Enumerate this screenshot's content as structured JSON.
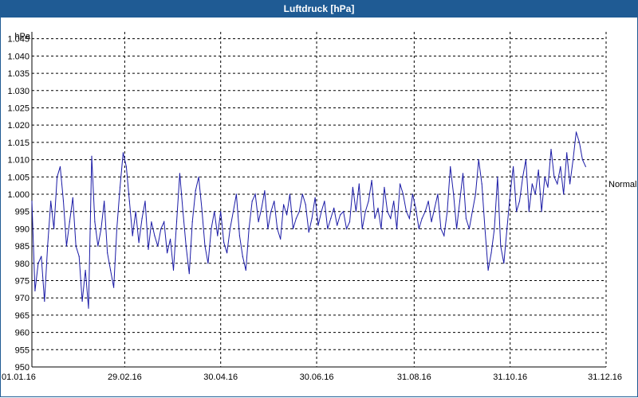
{
  "window": {
    "title": "Luftdruck [hPa]"
  },
  "chart_data": {
    "type": "line",
    "title": "Luftdruck [hPa]",
    "ylabel": "hPa",
    "ylim": [
      950,
      1047
    ],
    "y_ticks": [
      {
        "value": 1045,
        "label": "1.045"
      },
      {
        "value": 1040,
        "label": "1.040"
      },
      {
        "value": 1035,
        "label": "1.035"
      },
      {
        "value": 1030,
        "label": "1.030"
      },
      {
        "value": 1025,
        "label": "1.025"
      },
      {
        "value": 1020,
        "label": "1.020"
      },
      {
        "value": 1015,
        "label": "1.015"
      },
      {
        "value": 1010,
        "label": "1.010"
      },
      {
        "value": 1005,
        "label": "1.005"
      },
      {
        "value": 1000,
        "label": "1.000"
      },
      {
        "value": 995,
        "label": "995"
      },
      {
        "value": 990,
        "label": "990"
      },
      {
        "value": 985,
        "label": "985"
      },
      {
        "value": 980,
        "label": "980"
      },
      {
        "value": 975,
        "label": "975"
      },
      {
        "value": 970,
        "label": "970"
      },
      {
        "value": 965,
        "label": "965"
      },
      {
        "value": 960,
        "label": "960"
      },
      {
        "value": 955,
        "label": "955"
      },
      {
        "value": 950,
        "label": "950"
      }
    ],
    "x_ticks": [
      "01.01.16",
      "29.02.16",
      "30.04.16",
      "30.06.16",
      "31.08.16",
      "31.10.16",
      "31.12.16"
    ],
    "grid": true,
    "reference_line": {
      "label": "Normal",
      "value": 1003
    },
    "series": [
      {
        "color": "#1a1aa6",
        "points": [
          [
            "01.01.16",
            998
          ],
          [
            "03.01.16",
            972
          ],
          [
            "05.01.16",
            980
          ],
          [
            "07.01.16",
            982
          ],
          [
            "09.01.16",
            969
          ],
          [
            "11.01.16",
            985
          ],
          [
            "13.01.16",
            998
          ],
          [
            "15.01.16",
            990
          ],
          [
            "17.01.16",
            1005
          ],
          [
            "19.01.16",
            1008
          ],
          [
            "21.01.16",
            998
          ],
          [
            "23.01.16",
            985
          ],
          [
            "25.01.16",
            992
          ],
          [
            "27.01.16",
            999
          ],
          [
            "29.01.16",
            985
          ],
          [
            "31.01.16",
            982
          ],
          [
            "02.02.16",
            969
          ],
          [
            "04.02.16",
            978
          ],
          [
            "06.02.16",
            967
          ],
          [
            "08.02.16",
            1011
          ],
          [
            "10.02.16",
            992
          ],
          [
            "12.02.16",
            985
          ],
          [
            "14.02.16",
            990
          ],
          [
            "16.02.16",
            998
          ],
          [
            "18.02.16",
            983
          ],
          [
            "20.02.16",
            978
          ],
          [
            "22.02.16",
            973
          ],
          [
            "24.02.16",
            990
          ],
          [
            "26.02.16",
            1002
          ],
          [
            "28.02.16",
            1012
          ],
          [
            "01.03.16",
            1008
          ],
          [
            "03.03.16",
            998
          ],
          [
            "05.03.16",
            988
          ],
          [
            "07.03.16",
            995
          ],
          [
            "09.03.16",
            986
          ],
          [
            "11.03.16",
            993
          ],
          [
            "13.03.16",
            998
          ],
          [
            "15.03.16",
            984
          ],
          [
            "17.03.16",
            992
          ],
          [
            "19.03.16",
            988
          ],
          [
            "21.03.16",
            985
          ],
          [
            "23.03.16",
            990
          ],
          [
            "25.03.16",
            992
          ],
          [
            "27.03.16",
            983
          ],
          [
            "29.03.16",
            987
          ],
          [
            "31.03.16",
            978
          ],
          [
            "02.04.16",
            992
          ],
          [
            "04.04.16",
            1006
          ],
          [
            "06.04.16",
            995
          ],
          [
            "08.04.16",
            985
          ],
          [
            "10.04.16",
            977
          ],
          [
            "12.04.16",
            992
          ],
          [
            "14.04.16",
            1001
          ],
          [
            "16.04.16",
            1005
          ],
          [
            "18.04.16",
            996
          ],
          [
            "20.04.16",
            985
          ],
          [
            "22.04.16",
            980
          ],
          [
            "24.04.16",
            990
          ],
          [
            "26.04.16",
            995
          ],
          [
            "28.04.16",
            988
          ],
          [
            "30.04.16",
            995
          ],
          [
            "02.05.16",
            986
          ],
          [
            "04.05.16",
            983
          ],
          [
            "06.05.16",
            990
          ],
          [
            "08.05.16",
            995
          ],
          [
            "10.05.16",
            1000
          ],
          [
            "12.05.16",
            988
          ],
          [
            "14.05.16",
            982
          ],
          [
            "16.05.16",
            978
          ],
          [
            "18.05.16",
            990
          ],
          [
            "20.05.16",
            998
          ],
          [
            "22.05.16",
            1000
          ],
          [
            "24.05.16",
            992
          ],
          [
            "26.05.16",
            996
          ],
          [
            "28.05.16",
            1001
          ],
          [
            "30.05.16",
            990
          ],
          [
            "01.06.16",
            995
          ],
          [
            "03.06.16",
            998
          ],
          [
            "05.06.16",
            990
          ],
          [
            "07.06.16",
            987
          ],
          [
            "09.06.16",
            997
          ],
          [
            "11.06.16",
            994
          ],
          [
            "13.06.16",
            1000
          ],
          [
            "15.06.16",
            990
          ],
          [
            "17.06.16",
            993
          ],
          [
            "19.06.16",
            995
          ],
          [
            "21.06.16",
            1000
          ],
          [
            "23.06.16",
            997
          ],
          [
            "25.06.16",
            989
          ],
          [
            "27.06.16",
            993
          ],
          [
            "29.06.16",
            999
          ],
          [
            "01.07.16",
            991
          ],
          [
            "03.07.16",
            995
          ],
          [
            "05.07.16",
            998
          ],
          [
            "07.07.16",
            990
          ],
          [
            "09.07.16",
            993
          ],
          [
            "11.07.16",
            996
          ],
          [
            "13.07.16",
            991
          ],
          [
            "15.07.16",
            994
          ],
          [
            "17.07.16",
            995
          ],
          [
            "19.07.16",
            990
          ],
          [
            "21.07.16",
            992
          ],
          [
            "23.07.16",
            1002
          ],
          [
            "25.07.16",
            995
          ],
          [
            "27.07.16",
            1003
          ],
          [
            "29.07.16",
            990
          ],
          [
            "31.07.16",
            995
          ],
          [
            "02.08.16",
            998
          ],
          [
            "04.08.16",
            1004
          ],
          [
            "06.08.16",
            993
          ],
          [
            "08.08.16",
            996
          ],
          [
            "10.08.16",
            990
          ],
          [
            "12.08.16",
            1002
          ],
          [
            "14.08.16",
            995
          ],
          [
            "16.08.16",
            993
          ],
          [
            "18.08.16",
            998
          ],
          [
            "20.08.16",
            990
          ],
          [
            "22.08.16",
            1003
          ],
          [
            "24.08.16",
            1000
          ],
          [
            "26.08.16",
            995
          ],
          [
            "28.08.16",
            993
          ],
          [
            "30.08.16",
            1000
          ],
          [
            "01.09.16",
            996
          ],
          [
            "03.09.16",
            990
          ],
          [
            "05.09.16",
            993
          ],
          [
            "07.09.16",
            995
          ],
          [
            "09.09.16",
            998
          ],
          [
            "11.09.16",
            992
          ],
          [
            "13.09.16",
            996
          ],
          [
            "15.09.16",
            1000
          ],
          [
            "17.09.16",
            990
          ],
          [
            "19.09.16",
            988
          ],
          [
            "21.09.16",
            995
          ],
          [
            "23.09.16",
            1008
          ],
          [
            "25.09.16",
            1000
          ],
          [
            "27.09.16",
            990
          ],
          [
            "29.09.16",
            998
          ],
          [
            "01.10.16",
            1006
          ],
          [
            "03.10.16",
            993
          ],
          [
            "05.10.16",
            990
          ],
          [
            "07.10.16",
            995
          ],
          [
            "09.10.16",
            1000
          ],
          [
            "11.10.16",
            1010
          ],
          [
            "13.10.16",
            1003
          ],
          [
            "15.10.16",
            990
          ],
          [
            "17.10.16",
            978
          ],
          [
            "19.10.16",
            983
          ],
          [
            "21.10.16",
            990
          ],
          [
            "23.10.16",
            1005
          ],
          [
            "25.10.16",
            985
          ],
          [
            "27.10.16",
            980
          ],
          [
            "29.10.16",
            990
          ],
          [
            "31.10.16",
            1000
          ],
          [
            "02.11.16",
            1008
          ],
          [
            "04.11.16",
            995
          ],
          [
            "06.11.16",
            998
          ],
          [
            "08.11.16",
            1005
          ],
          [
            "10.11.16",
            1010
          ],
          [
            "12.11.16",
            995
          ],
          [
            "14.11.16",
            1003
          ],
          [
            "16.11.16",
            1000
          ],
          [
            "18.11.16",
            1007
          ],
          [
            "20.11.16",
            995
          ],
          [
            "22.11.16",
            1005
          ],
          [
            "24.11.16",
            1002
          ],
          [
            "26.11.16",
            1013
          ],
          [
            "28.11.16",
            1005
          ],
          [
            "30.11.16",
            1003
          ],
          [
            "02.12.16",
            1008
          ],
          [
            "04.12.16",
            1000
          ],
          [
            "06.12.16",
            1012
          ],
          [
            "08.12.16",
            1003
          ],
          [
            "10.12.16",
            1010
          ],
          [
            "12.12.16",
            1018
          ],
          [
            "14.12.16",
            1015
          ],
          [
            "16.12.16",
            1010
          ],
          [
            "18.12.16",
            1008
          ]
        ]
      }
    ]
  }
}
